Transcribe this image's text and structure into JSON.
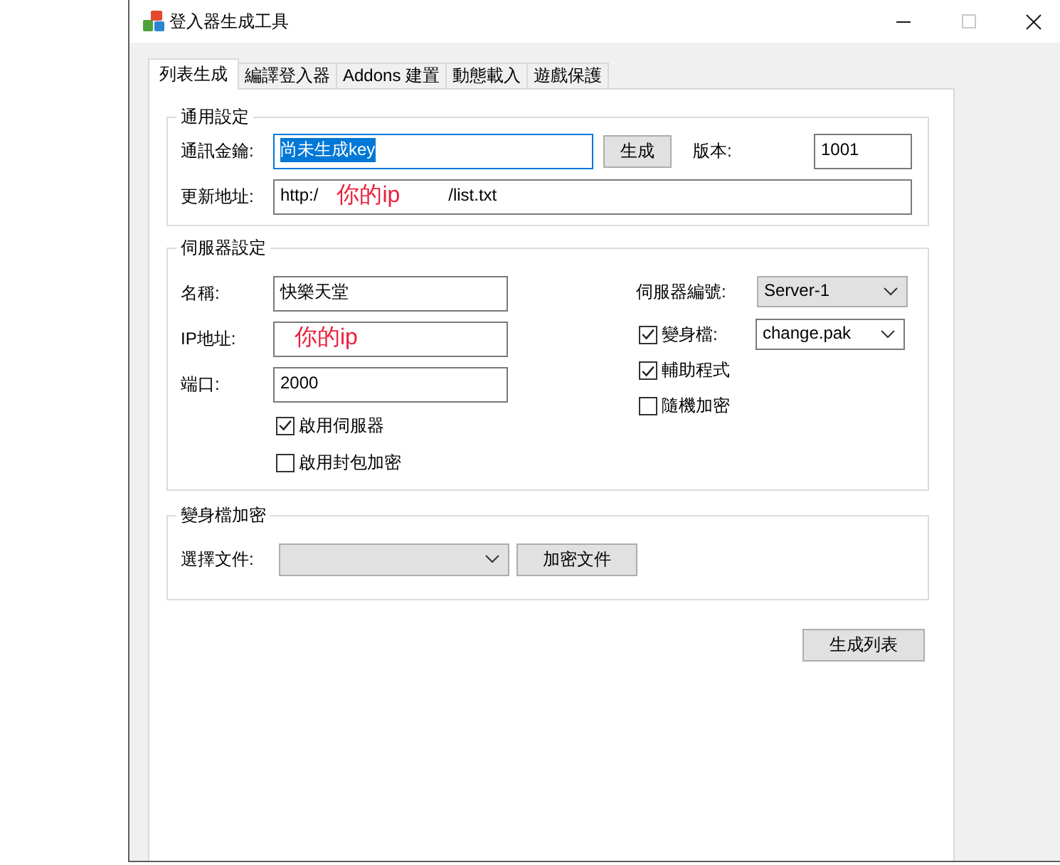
{
  "window": {
    "title": "登入器生成工具",
    "controls": [
      {
        "kind": "minimize",
        "disabled": false
      },
      {
        "kind": "maximize",
        "disabled": true
      },
      {
        "kind": "close",
        "disabled": false
      }
    ]
  },
  "tabs": [
    {
      "label": "列表生成",
      "selected": true
    },
    {
      "label": "編譯登入器",
      "selected": false
    },
    {
      "label": "Addons 建置",
      "selected": false
    },
    {
      "label": "動態載入",
      "selected": false
    },
    {
      "label": "遊戲保護",
      "selected": false
    }
  ],
  "general_settings": {
    "title": "通用設定",
    "key": {
      "label": "通訊金鑰:",
      "value": "尚未生成key",
      "focused": true
    },
    "generate_button": "生成",
    "version": {
      "label": "版本:",
      "value": "1001"
    },
    "update_url": {
      "label": "更新地址:",
      "value_start": "http:/",
      "overlay_note": "你的ip",
      "value_end": "/list.txt"
    }
  },
  "server_settings": {
    "title": "伺服器設定",
    "fields": [
      {
        "label": "名稱:",
        "value": "快樂天堂"
      },
      {
        "label": "IP地址:",
        "overlay_note": "你的ip"
      },
      {
        "label": "端口:",
        "value": "2000"
      }
    ],
    "left_checkboxes": [
      {
        "label": "啟用伺服器",
        "checked": true
      },
      {
        "label": "啟用封包加密",
        "checked": false
      }
    ],
    "server_number": {
      "label": "伺服器編號:",
      "kind": "list",
      "value": "Server-1"
    },
    "morph_file": {
      "label": "變身檔:",
      "checked": true,
      "kind": "combo",
      "value": "change.pak"
    },
    "right_checkboxes": [
      {
        "label": "輔助程式",
        "checked": true
      },
      {
        "label": "隨機加密",
        "checked": false
      }
    ]
  },
  "morph_encryption": {
    "title": "變身檔加密",
    "file_select": {
      "label": "選擇文件:",
      "kind": "list"
    },
    "encrypt_button": "加密文件"
  },
  "generate_list_button": "生成列表"
}
